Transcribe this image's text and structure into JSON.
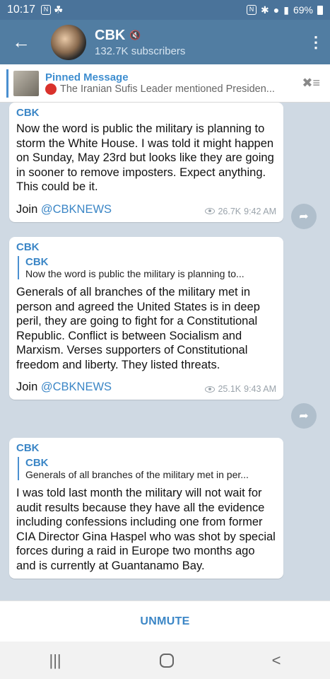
{
  "status_bar": {
    "time": "10:17",
    "battery": "69%"
  },
  "header": {
    "back_label": "←",
    "title": "CBK",
    "subtitle": "132.7K subscribers",
    "menu_label": "⋮"
  },
  "pinned": {
    "title": "Pinned Message",
    "preview": "The Iranian Sufis Leader mentioned Presiden..."
  },
  "messages": [
    {
      "sender": "CBK",
      "reply": null,
      "text": "Now the word is public the military is planning to storm the White House. I was told it might happen on Sunday, May 23rd but looks like they are going in sooner to remove imposters. Expect anything. This could be it.",
      "join_prefix": "Join ",
      "join_mention": "@CBKNEWS",
      "views": "26.7K",
      "time": "9:42 AM"
    },
    {
      "sender": "CBK",
      "reply": {
        "name": "CBK",
        "text": "Now the word is public the military is planning to..."
      },
      "text": "Generals of all branches of the military met in person and agreed the United States is in deep peril, they are going to fight for a Constitutional Republic. Conflict is between Socialism and Marxism. Verses supporters of Constitutional freedom and liberty. They listed threats.",
      "join_prefix": "Join ",
      "join_mention": "@CBKNEWS",
      "views": "25.1K",
      "time": "9:43 AM"
    },
    {
      "sender": "CBK",
      "reply": {
        "name": "CBK",
        "text": "Generals of all branches of the military met in per..."
      },
      "text": "I was told last month the military will not wait for audit results because they have all the evidence including confessions including one from former CIA Director Gina Haspel who was shot by special forces during a raid in Europe two months ago and is currently at Guantanamo Bay."
    }
  ],
  "footer": {
    "unmute_label": "UNMUTE"
  },
  "nav": {
    "recent": "|||",
    "back": "<"
  },
  "colors": {
    "header_bg": "#517da2",
    "accent": "#3b86c6",
    "chat_bg": "#cfd9e3"
  }
}
